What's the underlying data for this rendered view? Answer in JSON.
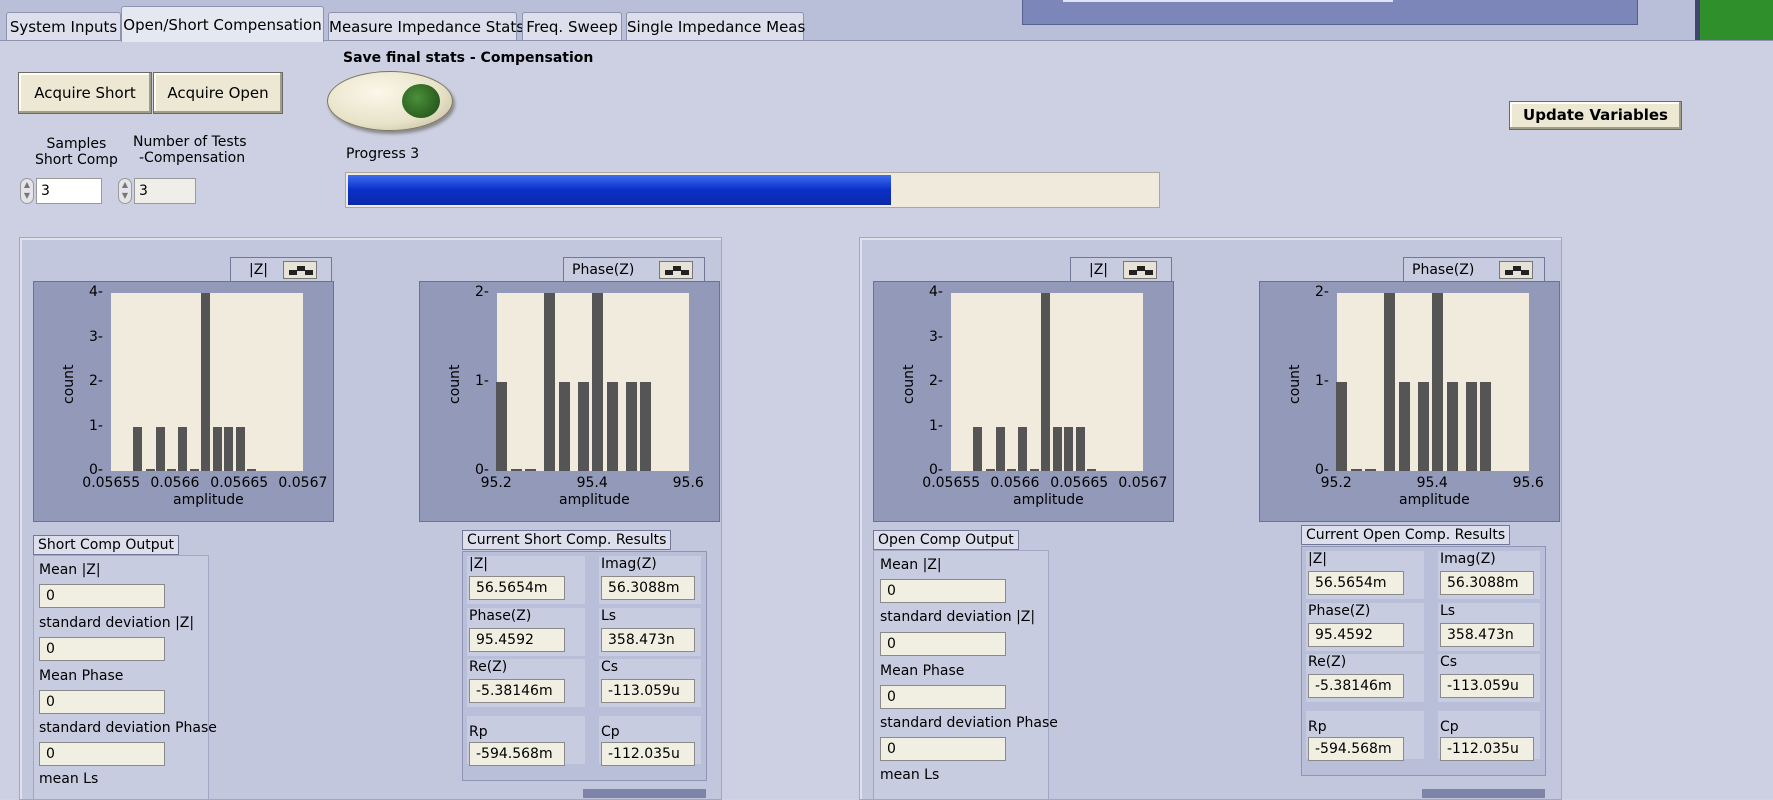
{
  "tabs": [
    {
      "label": "System Inputs"
    },
    {
      "label": "Open/Short Compensation"
    },
    {
      "label": "Measure Impedance Stats"
    },
    {
      "label": "Freq. Sweep"
    },
    {
      "label": "Single Impedance Meas"
    }
  ],
  "controls": {
    "acquire_short": "Acquire Short",
    "acquire_open": "Acquire Open",
    "save_stats_label": "Save final stats - Compensation",
    "samples_label_1": "Samples",
    "samples_label_2": "Short Comp",
    "samples_value": "3",
    "num_tests_label_1": "Number of Tests",
    "num_tests_label_2": "-Compensation",
    "num_tests_value": "3",
    "progress_label": "Progress 3",
    "progress_value": 0.67,
    "update_variables": "Update Variables"
  },
  "short_section": {
    "z_graph_label": "|Z|",
    "phase_graph_label": "Phase(Z)",
    "output_label": "Short Comp Output",
    "outputs": [
      {
        "label": "Mean |Z|",
        "value": "0"
      },
      {
        "label": "standard deviation |Z|",
        "value": "0"
      },
      {
        "label": "Mean Phase",
        "value": "0"
      },
      {
        "label": "standard deviation Phase",
        "value": "0"
      },
      {
        "label": "mean Ls",
        "value": ""
      }
    ],
    "results_label": "Current Short Comp. Results",
    "results": [
      {
        "label": "|Z|",
        "value": "56.5654m"
      },
      {
        "label": "Imag(Z)",
        "value": "56.3088m"
      },
      {
        "label": "Phase(Z)",
        "value": "95.4592"
      },
      {
        "label": "Ls",
        "value": "358.473n"
      },
      {
        "label": "Re(Z)",
        "value": "-5.38146m"
      },
      {
        "label": "Cs",
        "value": "-113.059u"
      },
      {
        "label": "Rp",
        "value": "-594.568m"
      },
      {
        "label": "Cp",
        "value": "-112.035u"
      }
    ]
  },
  "open_section": {
    "z_graph_label": "|Z|",
    "phase_graph_label": "Phase(Z)",
    "output_label": "Open Comp Output",
    "outputs": [
      {
        "label": "Mean |Z|",
        "value": "0"
      },
      {
        "label": "standard deviation |Z|",
        "value": "0"
      },
      {
        "label": "Mean Phase",
        "value": "0"
      },
      {
        "label": "standard deviation Phase",
        "value": "0"
      },
      {
        "label": "mean Ls",
        "value": ""
      }
    ],
    "results_label": "Current Open Comp. Results",
    "results": [
      {
        "label": "|Z|",
        "value": "56.5654m"
      },
      {
        "label": "Imag(Z)",
        "value": "56.3088m"
      },
      {
        "label": "Phase(Z)",
        "value": "95.4592"
      },
      {
        "label": "Ls",
        "value": "358.473n"
      },
      {
        "label": "Re(Z)",
        "value": "-5.38146m"
      },
      {
        "label": "Cs",
        "value": "-113.059u"
      },
      {
        "label": "Rp",
        "value": "-594.568m"
      },
      {
        "label": "Cp",
        "value": "-112.035u"
      }
    ]
  },
  "chart_data": [
    {
      "type": "bar",
      "label": "|Z|",
      "xlabel": "amplitude",
      "ylabel": "count",
      "xticks": [
        "0.05655",
        "0.0566",
        "0.05665",
        "0.0567"
      ],
      "yticks": [
        "0",
        "1",
        "2",
        "3",
        "4"
      ],
      "xlim": [
        0.05655,
        0.0567
      ],
      "ylim": [
        0,
        4
      ],
      "bin_centers": [
        0.056571,
        0.056581,
        0.056589,
        0.056597,
        0.056606,
        0.056615,
        0.056624,
        0.056633,
        0.056642,
        0.056651,
        0.05666
      ],
      "values": [
        1,
        0,
        1,
        0,
        1,
        0,
        4,
        1,
        1,
        1,
        0
      ]
    },
    {
      "type": "bar",
      "label": "Phase(Z)",
      "xlabel": "amplitude",
      "ylabel": "count",
      "xticks": [
        "95.2",
        "95.4",
        "95.6"
      ],
      "yticks": [
        "0",
        "1",
        "2"
      ],
      "xlim": [
        95.2,
        95.6
      ],
      "ylim": [
        0,
        2
      ],
      "bin_centers": [
        95.21,
        95.24,
        95.27,
        95.31,
        95.34,
        95.38,
        95.41,
        95.44,
        95.48,
        95.51
      ],
      "values": [
        1,
        0,
        0,
        2,
        1,
        1,
        2,
        1,
        1,
        1
      ]
    },
    {
      "type": "bar",
      "label": "|Z|",
      "xlabel": "amplitude",
      "ylabel": "count",
      "xticks": [
        "0.05655",
        "0.0566",
        "0.05665",
        "0.0567"
      ],
      "yticks": [
        "0",
        "1",
        "2",
        "3",
        "4"
      ],
      "xlim": [
        0.05655,
        0.0567
      ],
      "ylim": [
        0,
        4
      ],
      "bin_centers": [
        0.056571,
        0.056581,
        0.056589,
        0.056597,
        0.056606,
        0.056615,
        0.056624,
        0.056633,
        0.056642,
        0.056651,
        0.05666
      ],
      "values": [
        1,
        0,
        1,
        0,
        1,
        0,
        4,
        1,
        1,
        1,
        0
      ]
    },
    {
      "type": "bar",
      "label": "Phase(Z)",
      "xlabel": "amplitude",
      "ylabel": "count",
      "xticks": [
        "95.2",
        "95.4",
        "95.6"
      ],
      "yticks": [
        "0",
        "1",
        "2"
      ],
      "xlim": [
        95.2,
        95.6
      ],
      "ylim": [
        0,
        2
      ],
      "bin_centers": [
        95.21,
        95.24,
        95.27,
        95.31,
        95.34,
        95.38,
        95.41,
        95.44,
        95.48,
        95.51
      ],
      "values": [
        1,
        0,
        0,
        2,
        1,
        1,
        2,
        1,
        1,
        1
      ]
    }
  ]
}
